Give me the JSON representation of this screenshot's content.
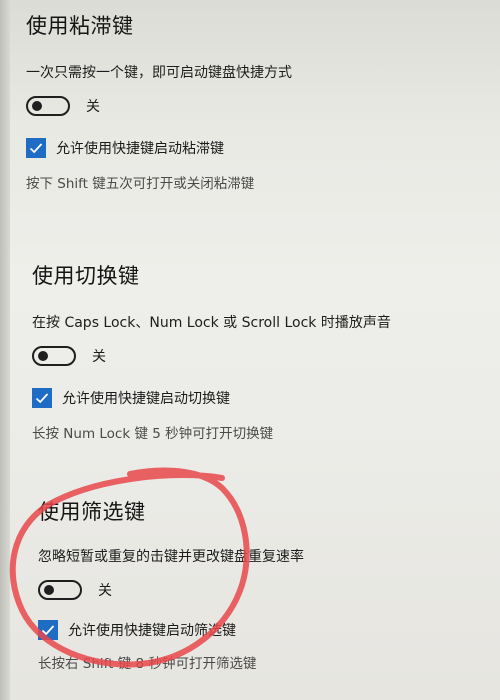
{
  "sticky_keys": {
    "title": "使用粘滞键",
    "description": "一次只需按一个键，即可启动键盘快捷方式",
    "toggle_state": "关",
    "shortcut_label": "允许使用快捷键启动粘滞键",
    "hint": "按下 Shift 键五次可打开或关闭粘滞键"
  },
  "toggle_keys": {
    "title": "使用切换键",
    "description": "在按 Caps Lock、Num Lock 或 Scroll Lock 时播放声音",
    "toggle_state": "关",
    "shortcut_label": "允许使用快捷键启动切换键",
    "hint": "长按 Num Lock 键 5 秒钟可打开切换键"
  },
  "filter_keys": {
    "title": "使用筛选键",
    "description": "忽略短暂或重复的击键并更改键盘重复速率",
    "toggle_state": "关",
    "shortcut_label": "允许使用快捷键启动筛选键",
    "hint": "长按右 Shift 键 8 秒钟可打开筛选键"
  },
  "colors": {
    "checkbox": "#1f6cc4",
    "annotation_circle": "#e8484a"
  },
  "icons": {
    "checkbox_mark": "checkmark-icon",
    "annotation": "red-hand-drawn-circle"
  }
}
